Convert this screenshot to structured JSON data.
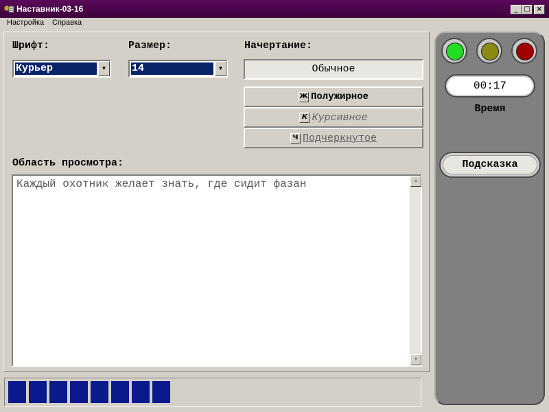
{
  "window": {
    "title": "Наставник-03-16",
    "minimize": "_",
    "maximize": "□",
    "close": "×"
  },
  "menu": [
    "Настройка",
    "Справка"
  ],
  "font": {
    "label": "Шрифт:",
    "value": "Курьер"
  },
  "size": {
    "label": "Размер:",
    "value": "14"
  },
  "style": {
    "label": "Начертание:",
    "current": "Обычное",
    "bold": {
      "key": "Ж",
      "label": "Полужирное"
    },
    "italic": {
      "key": "К",
      "label": "Курсивное"
    },
    "underline": {
      "key": "Ч",
      "label": "Подчеркнутое"
    }
  },
  "preview": {
    "label": "Область просмотра:",
    "text": "Каждый охотник желает знать, где сидит фазан"
  },
  "progress": {
    "filled_blocks": 8
  },
  "side": {
    "lights": [
      "#22dd22",
      "#8a8a10",
      "#a00000"
    ],
    "timer": "00:17",
    "time_label": "Время",
    "hint_button": "Подсказка"
  }
}
